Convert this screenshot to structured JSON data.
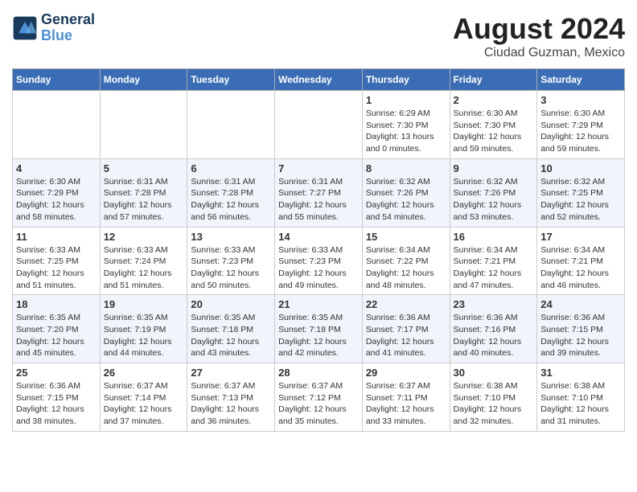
{
  "header": {
    "logo_line1": "General",
    "logo_line2": "Blue",
    "title": "August 2024",
    "subtitle": "Ciudad Guzman, Mexico"
  },
  "days_of_week": [
    "Sunday",
    "Monday",
    "Tuesday",
    "Wednesday",
    "Thursday",
    "Friday",
    "Saturday"
  ],
  "weeks": [
    {
      "cells": [
        {
          "day": null,
          "info": null
        },
        {
          "day": null,
          "info": null
        },
        {
          "day": null,
          "info": null
        },
        {
          "day": null,
          "info": null
        },
        {
          "day": "1",
          "info": "Sunrise: 6:29 AM\nSunset: 7:30 PM\nDaylight: 13 hours\nand 0 minutes."
        },
        {
          "day": "2",
          "info": "Sunrise: 6:30 AM\nSunset: 7:30 PM\nDaylight: 12 hours\nand 59 minutes."
        },
        {
          "day": "3",
          "info": "Sunrise: 6:30 AM\nSunset: 7:29 PM\nDaylight: 12 hours\nand 59 minutes."
        }
      ]
    },
    {
      "cells": [
        {
          "day": "4",
          "info": "Sunrise: 6:30 AM\nSunset: 7:29 PM\nDaylight: 12 hours\nand 58 minutes."
        },
        {
          "day": "5",
          "info": "Sunrise: 6:31 AM\nSunset: 7:28 PM\nDaylight: 12 hours\nand 57 minutes."
        },
        {
          "day": "6",
          "info": "Sunrise: 6:31 AM\nSunset: 7:28 PM\nDaylight: 12 hours\nand 56 minutes."
        },
        {
          "day": "7",
          "info": "Sunrise: 6:31 AM\nSunset: 7:27 PM\nDaylight: 12 hours\nand 55 minutes."
        },
        {
          "day": "8",
          "info": "Sunrise: 6:32 AM\nSunset: 7:26 PM\nDaylight: 12 hours\nand 54 minutes."
        },
        {
          "day": "9",
          "info": "Sunrise: 6:32 AM\nSunset: 7:26 PM\nDaylight: 12 hours\nand 53 minutes."
        },
        {
          "day": "10",
          "info": "Sunrise: 6:32 AM\nSunset: 7:25 PM\nDaylight: 12 hours\nand 52 minutes."
        }
      ]
    },
    {
      "cells": [
        {
          "day": "11",
          "info": "Sunrise: 6:33 AM\nSunset: 7:25 PM\nDaylight: 12 hours\nand 51 minutes."
        },
        {
          "day": "12",
          "info": "Sunrise: 6:33 AM\nSunset: 7:24 PM\nDaylight: 12 hours\nand 51 minutes."
        },
        {
          "day": "13",
          "info": "Sunrise: 6:33 AM\nSunset: 7:23 PM\nDaylight: 12 hours\nand 50 minutes."
        },
        {
          "day": "14",
          "info": "Sunrise: 6:33 AM\nSunset: 7:23 PM\nDaylight: 12 hours\nand 49 minutes."
        },
        {
          "day": "15",
          "info": "Sunrise: 6:34 AM\nSunset: 7:22 PM\nDaylight: 12 hours\nand 48 minutes."
        },
        {
          "day": "16",
          "info": "Sunrise: 6:34 AM\nSunset: 7:21 PM\nDaylight: 12 hours\nand 47 minutes."
        },
        {
          "day": "17",
          "info": "Sunrise: 6:34 AM\nSunset: 7:21 PM\nDaylight: 12 hours\nand 46 minutes."
        }
      ]
    },
    {
      "cells": [
        {
          "day": "18",
          "info": "Sunrise: 6:35 AM\nSunset: 7:20 PM\nDaylight: 12 hours\nand 45 minutes."
        },
        {
          "day": "19",
          "info": "Sunrise: 6:35 AM\nSunset: 7:19 PM\nDaylight: 12 hours\nand 44 minutes."
        },
        {
          "day": "20",
          "info": "Sunrise: 6:35 AM\nSunset: 7:18 PM\nDaylight: 12 hours\nand 43 minutes."
        },
        {
          "day": "21",
          "info": "Sunrise: 6:35 AM\nSunset: 7:18 PM\nDaylight: 12 hours\nand 42 minutes."
        },
        {
          "day": "22",
          "info": "Sunrise: 6:36 AM\nSunset: 7:17 PM\nDaylight: 12 hours\nand 41 minutes."
        },
        {
          "day": "23",
          "info": "Sunrise: 6:36 AM\nSunset: 7:16 PM\nDaylight: 12 hours\nand 40 minutes."
        },
        {
          "day": "24",
          "info": "Sunrise: 6:36 AM\nSunset: 7:15 PM\nDaylight: 12 hours\nand 39 minutes."
        }
      ]
    },
    {
      "cells": [
        {
          "day": "25",
          "info": "Sunrise: 6:36 AM\nSunset: 7:15 PM\nDaylight: 12 hours\nand 38 minutes."
        },
        {
          "day": "26",
          "info": "Sunrise: 6:37 AM\nSunset: 7:14 PM\nDaylight: 12 hours\nand 37 minutes."
        },
        {
          "day": "27",
          "info": "Sunrise: 6:37 AM\nSunset: 7:13 PM\nDaylight: 12 hours\nand 36 minutes."
        },
        {
          "day": "28",
          "info": "Sunrise: 6:37 AM\nSunset: 7:12 PM\nDaylight: 12 hours\nand 35 minutes."
        },
        {
          "day": "29",
          "info": "Sunrise: 6:37 AM\nSunset: 7:11 PM\nDaylight: 12 hours\nand 33 minutes."
        },
        {
          "day": "30",
          "info": "Sunrise: 6:38 AM\nSunset: 7:10 PM\nDaylight: 12 hours\nand 32 minutes."
        },
        {
          "day": "31",
          "info": "Sunrise: 6:38 AM\nSunset: 7:10 PM\nDaylight: 12 hours\nand 31 minutes."
        }
      ]
    }
  ]
}
